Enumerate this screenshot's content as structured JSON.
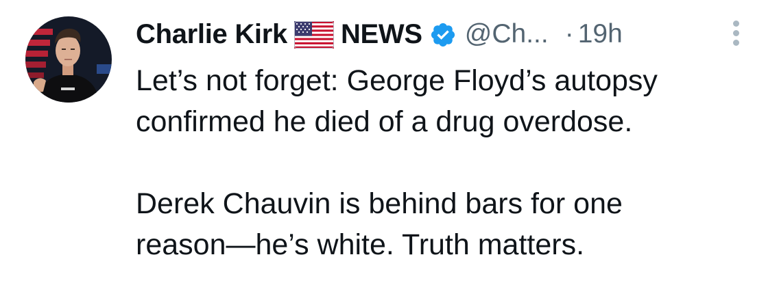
{
  "author": {
    "display_name": "Charlie Kirk",
    "name_suffix": "NEWS",
    "handle": "@Ch...",
    "flag_icon": "us-flag-icon",
    "verified_icon": "verified-badge-icon",
    "verified_color": "#1d9bf0"
  },
  "meta": {
    "separator": "·",
    "timestamp": "19h"
  },
  "tweet": {
    "lines": [
      "Let’s not forget: George Floyd’s autopsy",
      "confirmed he died of a drug overdose.",
      "",
      "Derek Chauvin is behind bars for one",
      "reason—he’s white. Truth matters."
    ]
  },
  "colors": {
    "text_primary": "#0f1419",
    "text_secondary": "#536471",
    "background": "#ffffff"
  }
}
